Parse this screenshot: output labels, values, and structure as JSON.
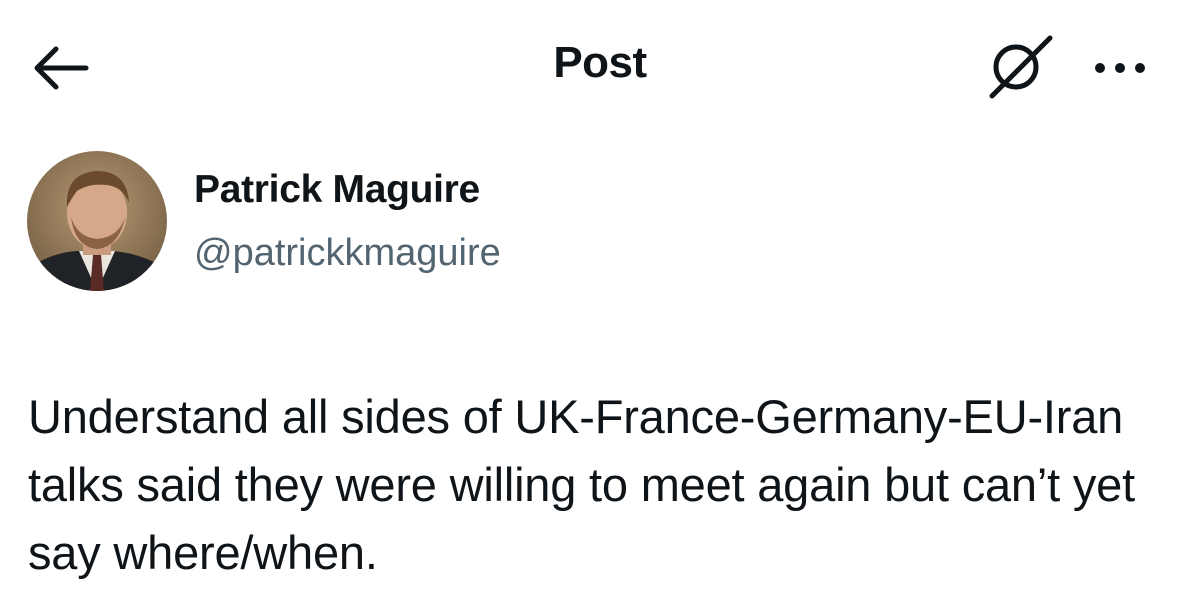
{
  "header": {
    "title": "Post",
    "back_icon": "arrow-left-icon",
    "grok_icon": "grok-icon",
    "more_icon": "more-horizontal-icon"
  },
  "author": {
    "name": "Patrick Maguire",
    "handle": "@patrickkmaguire",
    "avatar": "avatar-photo"
  },
  "post": {
    "text": "Understand all sides of UK-France-Germany-EU-Iran talks said they were willing to meet again but can’t yet say where/when."
  },
  "colors": {
    "text_primary": "#0f1419",
    "text_secondary": "#536471",
    "background": "#ffffff"
  }
}
